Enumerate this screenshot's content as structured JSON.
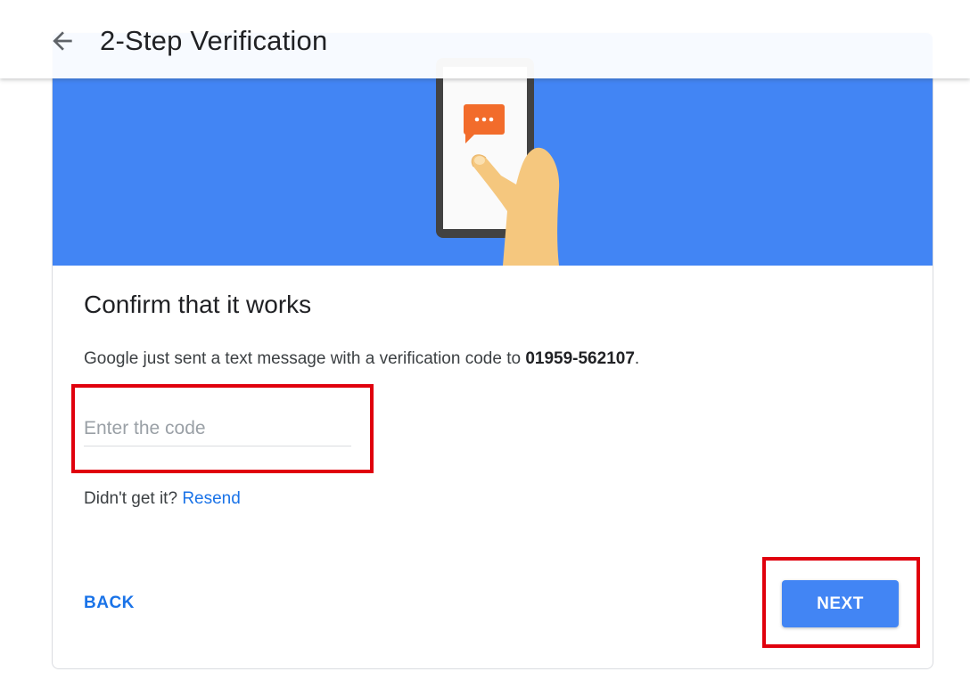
{
  "header": {
    "title": "2-Step Verification",
    "back_icon": "arrow-back-icon"
  },
  "illustration": {
    "description_icon": "phone-sms-illustration",
    "bubble_text": "···"
  },
  "content": {
    "heading": "Confirm that it works",
    "description_prefix": "Google just sent a text message with a verification code to ",
    "phone_number": "01959-562107",
    "description_suffix": "."
  },
  "code_input": {
    "placeholder": "Enter the code",
    "value": ""
  },
  "resend": {
    "prompt": "Didn't get it?",
    "link_label": "Resend"
  },
  "actions": {
    "back_label": "BACK",
    "next_label": "NEXT"
  },
  "colors": {
    "accent": "#4285f4",
    "link": "#1a73e8",
    "highlight": "#e0000d",
    "bubble": "#f26c2b"
  }
}
